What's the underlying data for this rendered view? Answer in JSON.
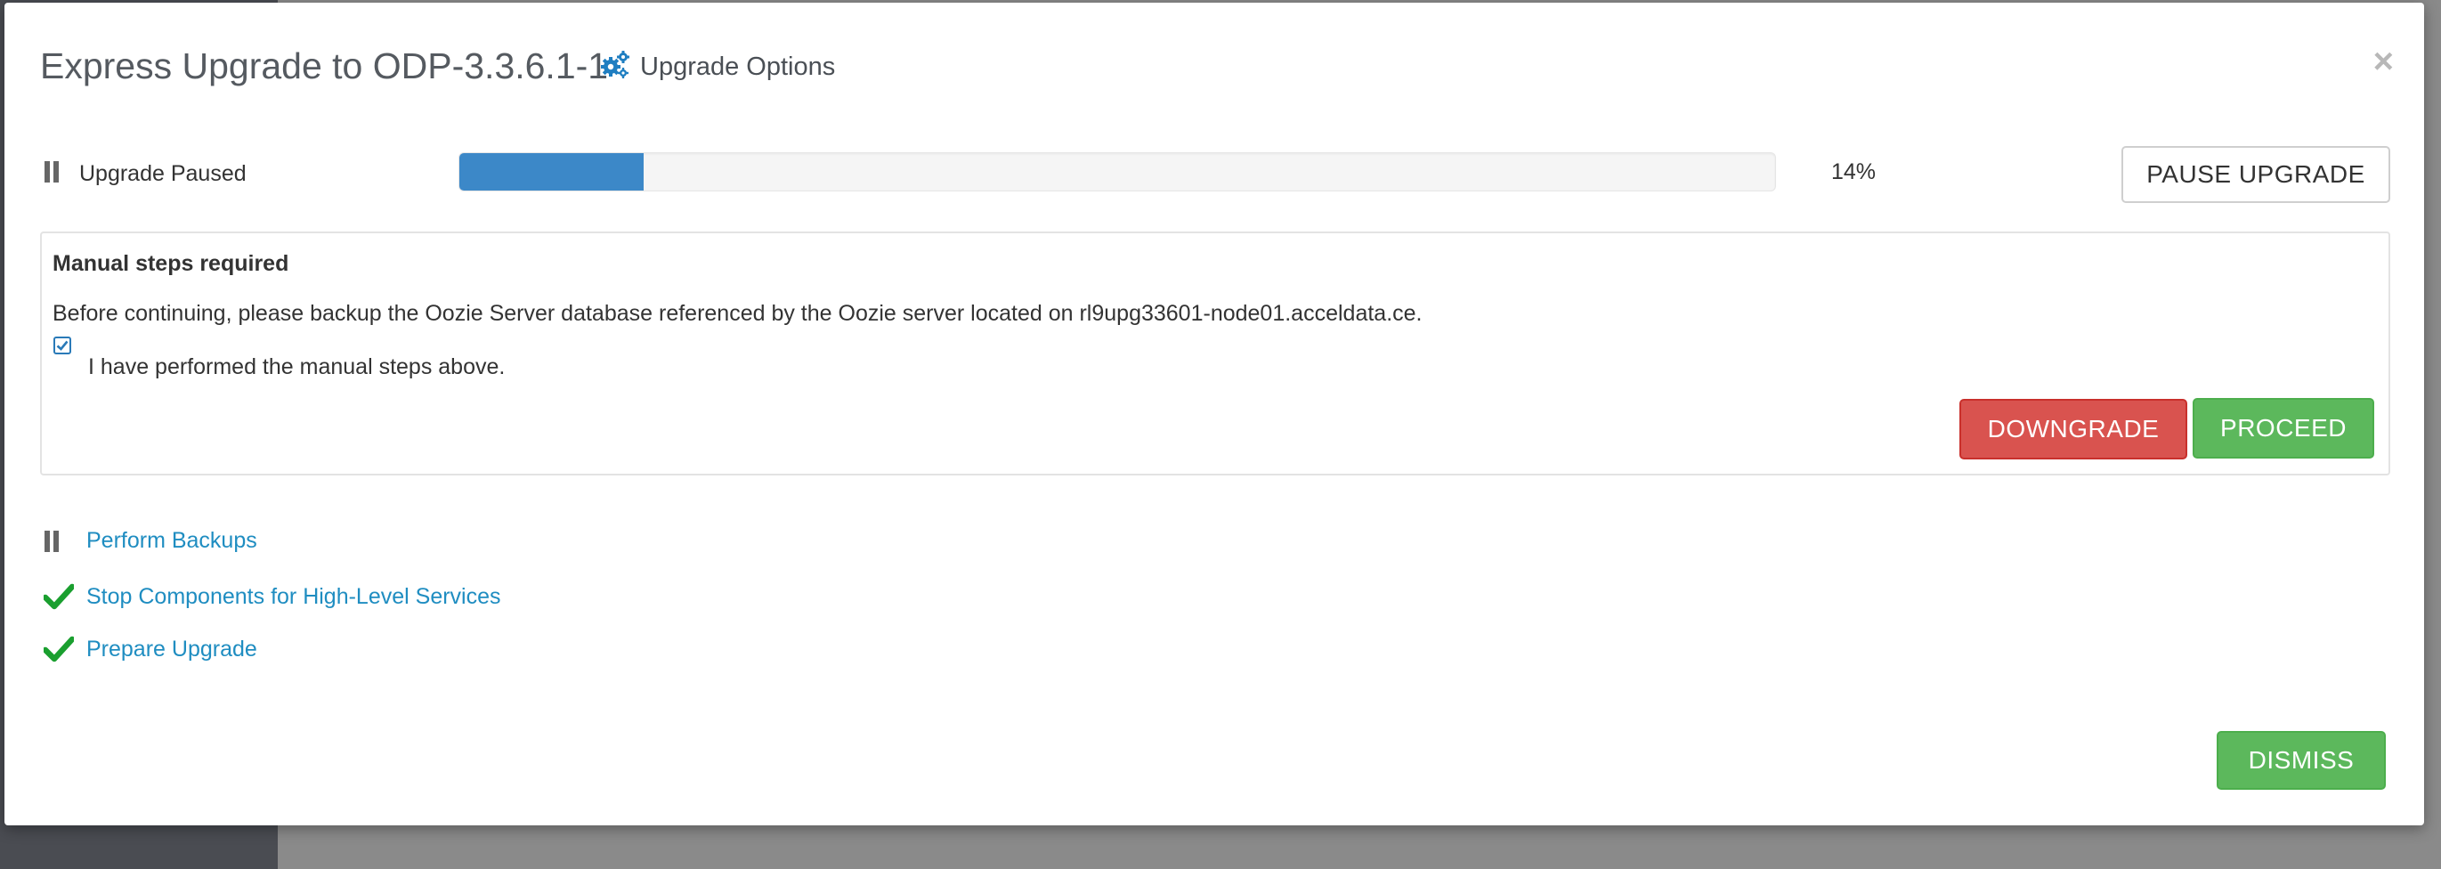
{
  "modal": {
    "title": "Express Upgrade to ODP-3.3.6.1-1",
    "options_label": "Upgrade Options",
    "close_symbol": "×"
  },
  "status": {
    "text": "Upgrade Paused",
    "icon": "pause-icon",
    "progress_percent": 14,
    "progress_label": "14%",
    "pause_button": "PAUSE UPGRADE"
  },
  "manual": {
    "title": "Manual steps required",
    "message": "Before continuing, please backup the Oozie Server database referenced by the Oozie server located on rl9upg33601-node01.acceldata.ce.",
    "checkbox_checked": true,
    "checkbox_label": "I have performed the manual steps above.",
    "downgrade_button": "DOWNGRADE",
    "proceed_button": "PROCEED"
  },
  "steps": [
    {
      "label": "Perform Backups",
      "status": "paused",
      "icon": "pause-icon"
    },
    {
      "label": "Stop Components for High-Level Services",
      "status": "done",
      "icon": "check-icon"
    },
    {
      "label": "Prepare Upgrade",
      "status": "done",
      "icon": "check-icon"
    }
  ],
  "footer": {
    "dismiss_button": "DISMISS"
  },
  "colors": {
    "progress": "#3c88c8",
    "link": "#1f8dc1",
    "danger": "#d9534f",
    "success": "#5cb85c",
    "check": "#1a9f2f"
  }
}
